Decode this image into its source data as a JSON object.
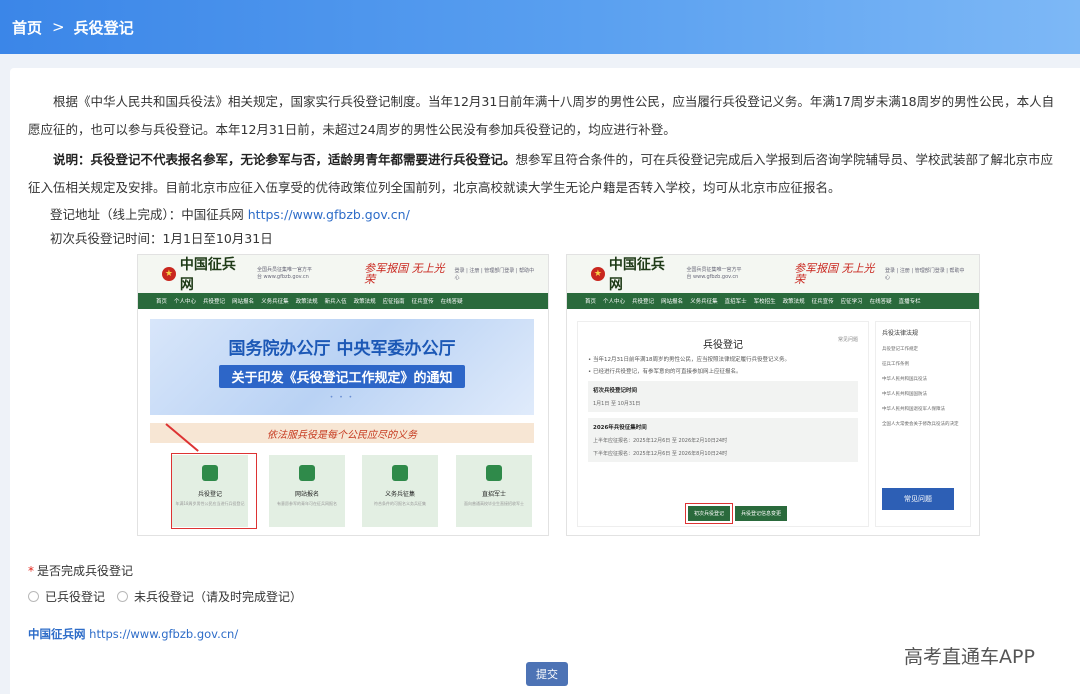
{
  "breadcrumb": {
    "home": "首页",
    "separator": ">",
    "current": "兵役登记"
  },
  "intro": {
    "p1": "根据《中华人民共和国兵役法》相关规定，国家实行兵役登记制度。当年12月31日前年满十八周岁的男性公民，应当履行兵役登记义务。年满17周岁未满18周岁的男性公民，本人自愿应征的，也可以参与兵役登记。本年12月31日前，未超过24周岁的男性公民没有参加兵役登记的，均应进行补登。",
    "p2_bold": "说明：兵役登记不代表报名参军，无论参军与否，适龄男青年都需要进行兵役登记。",
    "p2_rest": "想参军且符合条件的，可在兵役登记完成后入学报到后咨询学院辅导员、学校武装部了解北京市应征入伍相关规定及安排。目前北京市应征入伍享受的优待政策位列全国前列，北京高校就读大学生无论户籍是否转入学校，均可从北京市应征报名。",
    "addr_label": "登记地址（线上完成）：中国征兵网",
    "addr_url": "https://www.gfbzb.gov.cn/",
    "time_text": "初次兵役登记时间：1月1日至10月31日"
  },
  "shot_left": {
    "logo": "中国征兵网",
    "slogan_small": "全国兵员征集唯一官方平台 www.gfbzb.gov.cn",
    "slogan_red": "参军报国 无上光荣",
    "head_links": "登录 | 注册 | 管理部门登录 | 帮助中心",
    "nav": [
      "首页",
      "个人中心",
      "兵役登记",
      "网站报名",
      "义务兵征集",
      "政策法规",
      "新兵入伍",
      "政策法规",
      "应征指南",
      "征兵宣传",
      "在线答疑"
    ],
    "banner_t1": "国务院办公厅  中央军委办公厅",
    "banner_t2": "关于印发《兵役登记工作规定》的通知",
    "dots": "• • •",
    "strip": "依法服兵役是每个公民应尽的义务",
    "tiles": [
      {
        "label": "兵役登记",
        "sub": "年满18周岁男性公民应当进行兵役登记"
      },
      {
        "label": "网站报名",
        "sub": "有意愿参军的青年可在征兵网报名"
      },
      {
        "label": "义务兵征集",
        "sub": "符合条件的可报名义务兵征集"
      },
      {
        "label": "直招军士",
        "sub": "面向普通高校毕业生直接招收军士"
      }
    ]
  },
  "shot_right": {
    "logo": "中国征兵网",
    "slogan_small": "全国兵员征集唯一官方平台 www.gfbzb.gov.cn",
    "slogan_red": "参军报国 无上光荣",
    "head_links": "登录 | 注册 | 管理部门登录 | 帮助中心",
    "nav": [
      "首页",
      "个人中心",
      "兵役登记",
      "网站报名",
      "义务兵征集",
      "直招军士",
      "军校招生",
      "政策法规",
      "征兵宣传",
      "应征学习",
      "在线答疑",
      "直播专栏"
    ],
    "title": "兵役登记",
    "faq": "常见问题",
    "bullet1": "• 当年12月31日前年满18周岁的男性公民，应当按照法律规定履行兵役登记义务。",
    "bullet2": "• 已经进行兵役登记，有参军意向的可直接参加网上应征报名。",
    "box1_h": "初次兵役登记时间",
    "box1_l": "1月1日 至 10月31日",
    "box2_h": "2026年兵役征集时间",
    "box2_l1": "上半年应征报名：2025年12月6日 至 2026年2月10日24时",
    "box2_l2": "下半年应征报名：2025年12月6日 至 2026年8月10日24时",
    "btn1": "初次兵役登记",
    "btn2": "兵役登记信息变更",
    "side_h": "兵役法律法规",
    "side_items": [
      "兵役登记工作规定",
      "征兵工作条例",
      "中华人民共和国兵役法",
      "中华人民共和国国防法",
      "中华人民共和国退役军人保障法",
      "全国人大常委会关于修改兵役法的决定"
    ],
    "side_btn": "常见问题"
  },
  "question": {
    "required_mark": "*",
    "label": "是否完成兵役登记"
  },
  "options": [
    "已兵役登记",
    "未兵役登记（请及时完成登记）"
  ],
  "footer": {
    "site": "中国征兵网",
    "url": "https://www.gfbzb.gov.cn/"
  },
  "submit": "提交",
  "watermark": "高考直通车APP",
  "colors": {
    "header_blue": "#3b86e8",
    "nav_green": "#2a6a3c",
    "link_blue": "#2d6cc8",
    "required_red": "#e2231a",
    "submit_blue": "#4d73b5"
  }
}
